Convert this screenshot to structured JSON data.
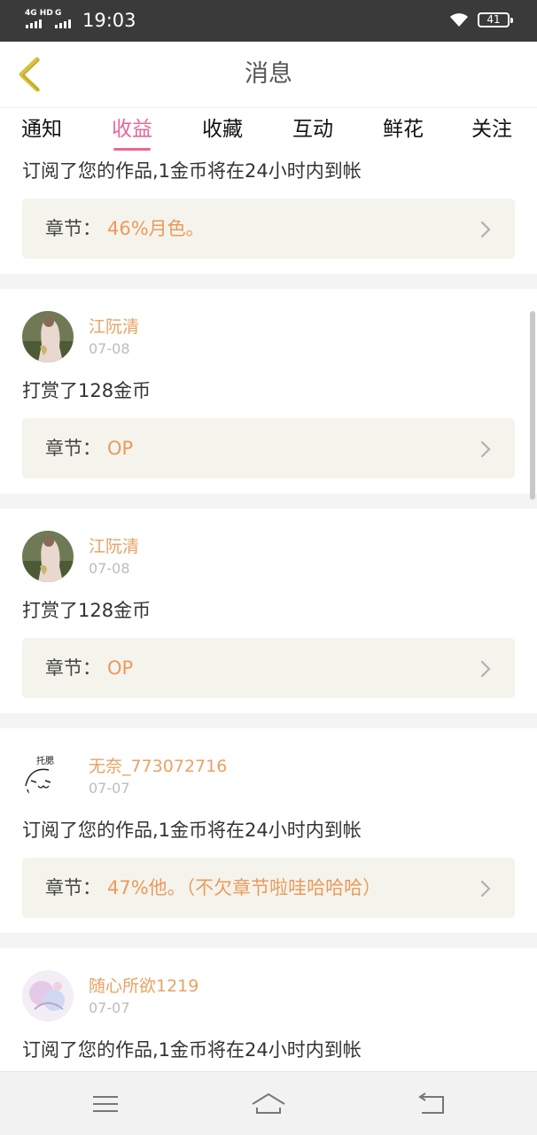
{
  "status_bar": {
    "network_1": "4G HD",
    "network_2": "G",
    "time": "19:03",
    "battery": "41"
  },
  "header": {
    "title": "消息"
  },
  "tabs": [
    {
      "label": "通知",
      "active": false
    },
    {
      "label": "收益",
      "active": true
    },
    {
      "label": "收藏",
      "active": false
    },
    {
      "label": "互动",
      "active": false
    },
    {
      "label": "鲜花",
      "active": false
    },
    {
      "label": "关注",
      "active": false
    }
  ],
  "chapter_label": "章节：",
  "items": [
    {
      "desc": "订阅了您的作品,1金币将在24小时内到帐",
      "chapter": "46%月色。"
    },
    {
      "user": "江阮清",
      "date": "07-08",
      "desc": "打赏了128金币",
      "chapter": "OP"
    },
    {
      "user": "江阮清",
      "date": "07-08",
      "desc": "打赏了128金币",
      "chapter": "OP"
    },
    {
      "user": "无奈_773072716",
      "date": "07-07",
      "desc": "订阅了您的作品,1金币将在24小时内到帐",
      "chapter": "47%他。（不欠章节啦哇哈哈哈）",
      "avatar_text": "托腮"
    },
    {
      "user": "随心所欲1219",
      "date": "07-07",
      "desc": "订阅了您的作品,1金币将在24小时内到帐"
    }
  ],
  "colors": {
    "accent": "#e7679a",
    "username": "#e8a264",
    "chapter_value": "#ea9a5c",
    "back_arrow": "#d9c23a"
  },
  "bottom_nav": [
    "menu-icon",
    "home-icon",
    "back-icon"
  ]
}
